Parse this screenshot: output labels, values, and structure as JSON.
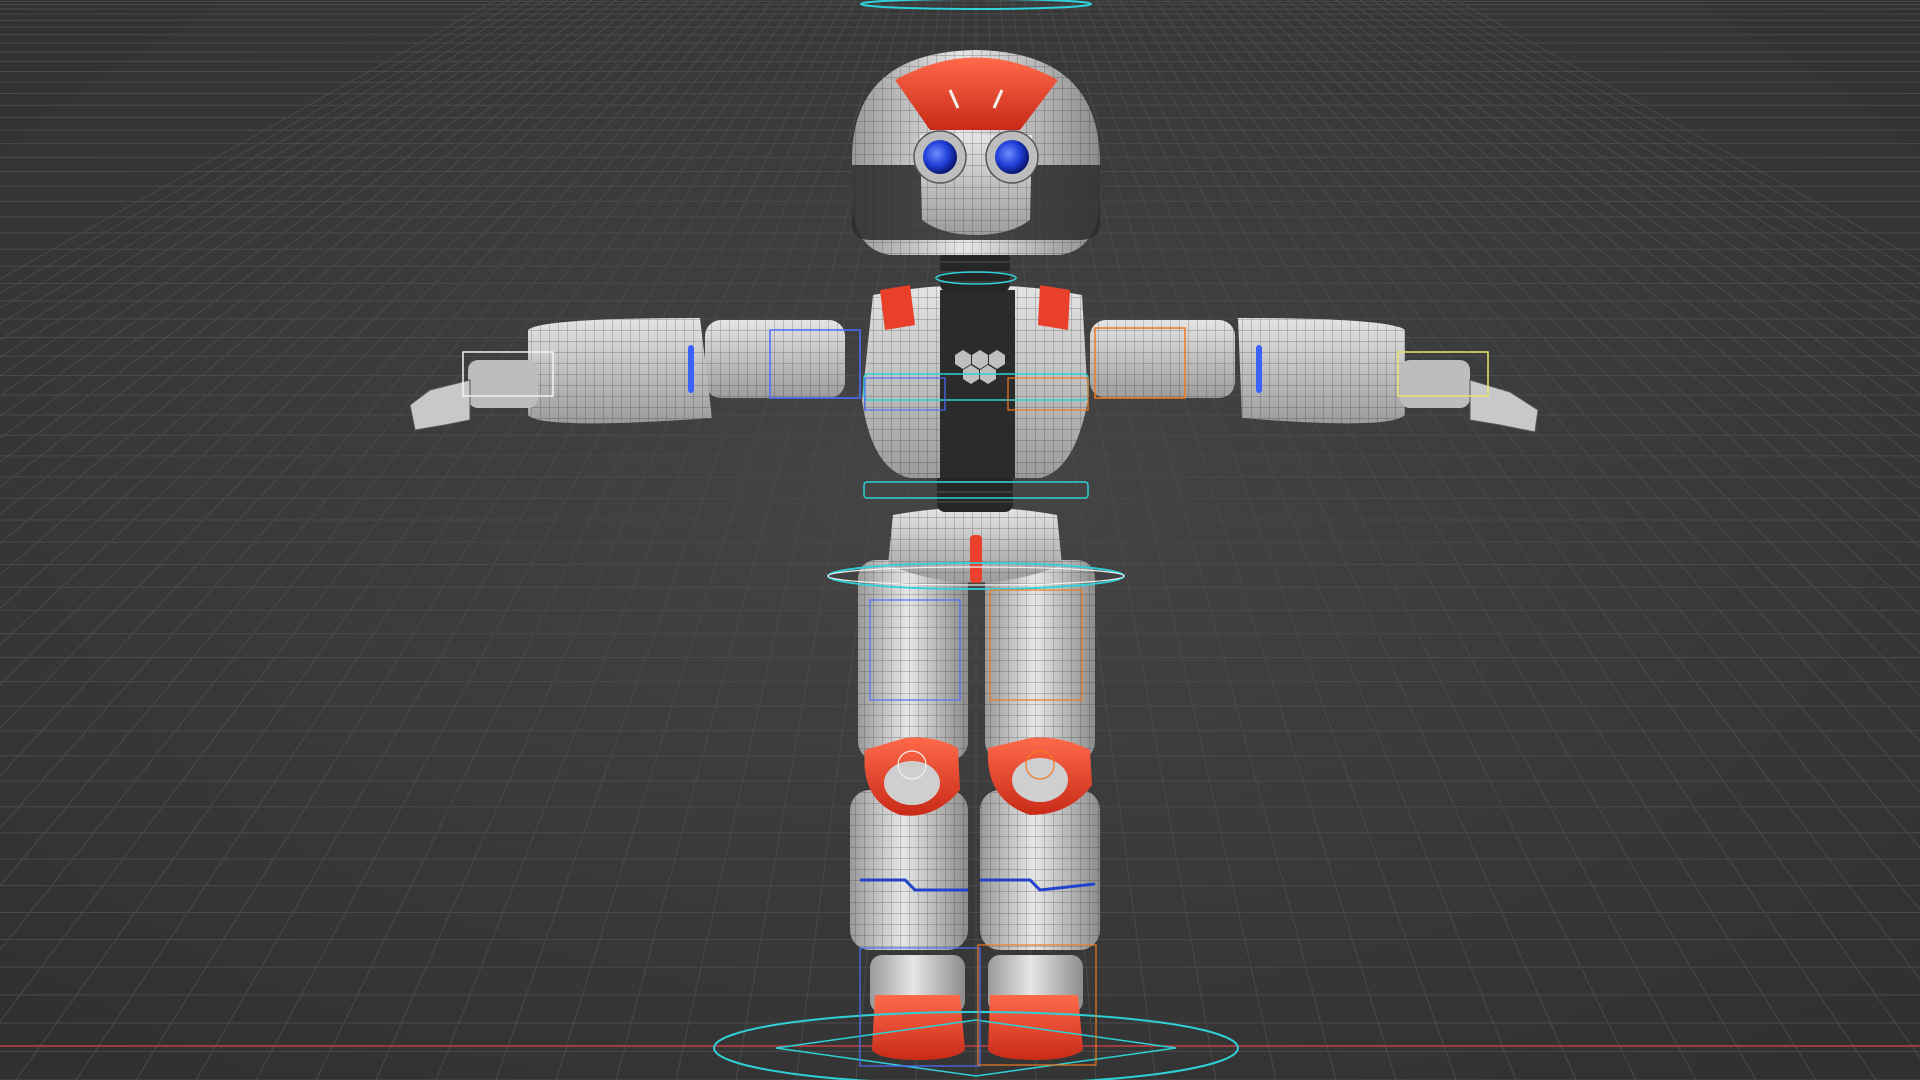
{
  "viewport": {
    "kind": "3d-viewport",
    "background_color": "#3b3b3b",
    "grid_line_color": "#4a4a4a",
    "x_axis_color": "#c04040"
  },
  "model": {
    "name_visible": false,
    "pose": "T-pose",
    "wireframe_overlay": true,
    "colors": {
      "shell_white": "#d9d9d9",
      "shell_shadow": "#9a9a9a",
      "joint_dark": "#2a2a2a",
      "accent_red": "#e8402a",
      "eye_blue": "#1f3fd8",
      "rig_cyan": "#2fd0d8",
      "rig_orange": "#ef7a22",
      "rig_blue": "#4d6dff",
      "rig_yellow": "#e9e46a",
      "rig_white": "#f2f2f2"
    }
  },
  "icons": {
    "chest_emblem": "hexagon-cluster-icon"
  }
}
